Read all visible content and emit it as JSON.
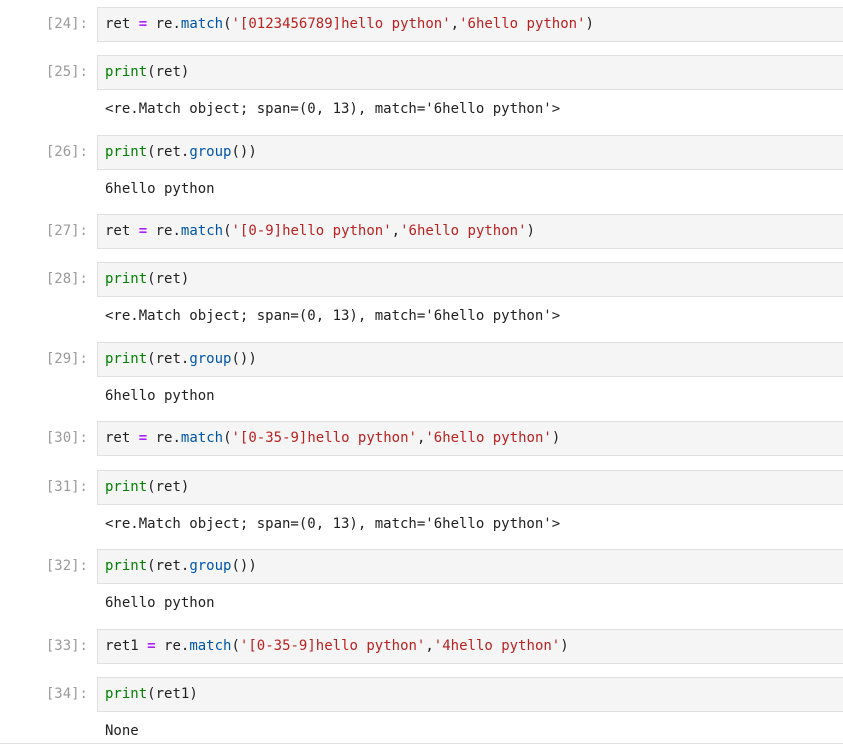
{
  "cells": [
    {
      "prompt": "[24]:",
      "tokens": [
        [
          "var",
          "ret"
        ],
        [
          "punc",
          " "
        ],
        [
          "op",
          "="
        ],
        [
          "punc",
          " "
        ],
        [
          "var",
          "re"
        ],
        [
          "punc",
          "."
        ],
        [
          "attr",
          "match"
        ],
        [
          "punc",
          "("
        ],
        [
          "str",
          "'[0123456789]hello python'"
        ],
        [
          "punc",
          ","
        ],
        [
          "str",
          "'6hello python'"
        ],
        [
          "punc",
          ")"
        ]
      ],
      "output": null
    },
    {
      "prompt": "[25]:",
      "tokens": [
        [
          "fn",
          "print"
        ],
        [
          "punc",
          "("
        ],
        [
          "var",
          "ret"
        ],
        [
          "punc",
          ")"
        ]
      ],
      "output": "<re.Match object; span=(0, 13), match='6hello python'>"
    },
    {
      "prompt": "[26]:",
      "tokens": [
        [
          "fn",
          "print"
        ],
        [
          "punc",
          "("
        ],
        [
          "var",
          "ret"
        ],
        [
          "punc",
          "."
        ],
        [
          "attr",
          "group"
        ],
        [
          "punc",
          "())"
        ]
      ],
      "output": "6hello python"
    },
    {
      "prompt": "[27]:",
      "tokens": [
        [
          "var",
          "ret"
        ],
        [
          "punc",
          " "
        ],
        [
          "op",
          "="
        ],
        [
          "punc",
          " "
        ],
        [
          "var",
          "re"
        ],
        [
          "punc",
          "."
        ],
        [
          "attr",
          "match"
        ],
        [
          "punc",
          "("
        ],
        [
          "str",
          "'[0-9]hello python'"
        ],
        [
          "punc",
          ","
        ],
        [
          "str",
          "'6hello python'"
        ],
        [
          "punc",
          ")"
        ]
      ],
      "output": null
    },
    {
      "prompt": "[28]:",
      "tokens": [
        [
          "fn",
          "print"
        ],
        [
          "punc",
          "("
        ],
        [
          "var",
          "ret"
        ],
        [
          "punc",
          ")"
        ]
      ],
      "output": "<re.Match object; span=(0, 13), match='6hello python'>"
    },
    {
      "prompt": "[29]:",
      "tokens": [
        [
          "fn",
          "print"
        ],
        [
          "punc",
          "("
        ],
        [
          "var",
          "ret"
        ],
        [
          "punc",
          "."
        ],
        [
          "attr",
          "group"
        ],
        [
          "punc",
          "())"
        ]
      ],
      "output": "6hello python"
    },
    {
      "prompt": "[30]:",
      "tokens": [
        [
          "var",
          "ret"
        ],
        [
          "punc",
          " "
        ],
        [
          "op",
          "="
        ],
        [
          "punc",
          " "
        ],
        [
          "var",
          "re"
        ],
        [
          "punc",
          "."
        ],
        [
          "attr",
          "match"
        ],
        [
          "punc",
          "("
        ],
        [
          "str",
          "'[0-35-9]hello python'"
        ],
        [
          "punc",
          ","
        ],
        [
          "str",
          "'6hello python'"
        ],
        [
          "punc",
          ")"
        ]
      ],
      "output": null
    },
    {
      "prompt": "[31]:",
      "tokens": [
        [
          "fn",
          "print"
        ],
        [
          "punc",
          "("
        ],
        [
          "var",
          "ret"
        ],
        [
          "punc",
          ")"
        ]
      ],
      "output": "<re.Match object; span=(0, 13), match='6hello python'>"
    },
    {
      "prompt": "[32]:",
      "tokens": [
        [
          "fn",
          "print"
        ],
        [
          "punc",
          "("
        ],
        [
          "var",
          "ret"
        ],
        [
          "punc",
          "."
        ],
        [
          "attr",
          "group"
        ],
        [
          "punc",
          "())"
        ]
      ],
      "output": "6hello python"
    },
    {
      "prompt": "[33]:",
      "tokens": [
        [
          "var",
          "ret1"
        ],
        [
          "punc",
          " "
        ],
        [
          "op",
          "="
        ],
        [
          "punc",
          " "
        ],
        [
          "var",
          "re"
        ],
        [
          "punc",
          "."
        ],
        [
          "attr",
          "match"
        ],
        [
          "punc",
          "("
        ],
        [
          "str",
          "'[0-35-9]hello python'"
        ],
        [
          "punc",
          ","
        ],
        [
          "str",
          "'4hello python'"
        ],
        [
          "punc",
          ")"
        ]
      ],
      "output": null
    },
    {
      "prompt": "[34]:",
      "tokens": [
        [
          "fn",
          "print"
        ],
        [
          "punc",
          "("
        ],
        [
          "var",
          "ret1"
        ],
        [
          "punc",
          ")"
        ]
      ],
      "output": "None"
    }
  ]
}
